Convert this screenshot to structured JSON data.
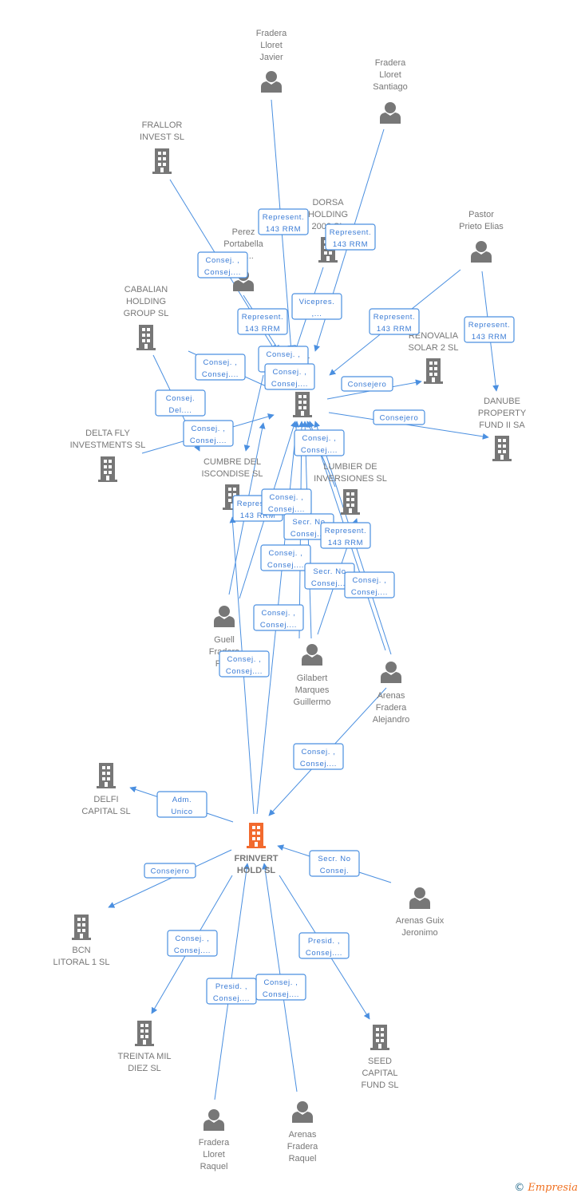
{
  "colors": {
    "edge": "#4a8fe0",
    "edge_text": "#3a7bd5",
    "node_icon": "#777777",
    "main_node": "#f26a2e"
  },
  "nodes": [
    {
      "id": "fradera_javier",
      "type": "person",
      "label": [
        "Fradera",
        "Lloret",
        "Javier"
      ]
    },
    {
      "id": "fradera_santiago",
      "type": "person",
      "label": [
        "Fradera",
        "Lloret",
        "Santiago"
      ]
    },
    {
      "id": "frallor",
      "type": "company",
      "label": [
        "FRALLOR",
        "INVEST SL"
      ]
    },
    {
      "id": "dorsa",
      "type": "company",
      "label": [
        "DORSA",
        "HOLDING",
        "2002 SL"
      ]
    },
    {
      "id": "perez",
      "type": "person",
      "label": [
        "Perez",
        "Portabella",
        "Fra..."
      ]
    },
    {
      "id": "pastor",
      "type": "person",
      "label": [
        "Pastor",
        "Prieto Elias"
      ]
    },
    {
      "id": "cabalian",
      "type": "company",
      "label": [
        "CABALIAN",
        "HOLDING",
        "GROUP SL"
      ]
    },
    {
      "id": "renovalia",
      "type": "company",
      "label": [
        "RENOVALIA",
        "SOLAR 2 SL"
      ]
    },
    {
      "id": "central",
      "type": "company",
      "label": [
        "MIL",
        "OS"
      ]
    },
    {
      "id": "danube",
      "type": "company",
      "label": [
        "DANUBE",
        "PROPERTY",
        "FUND II SA"
      ]
    },
    {
      "id": "delta",
      "type": "company",
      "label": [
        "DELTA FLY",
        "INVESTMENTS SL"
      ]
    },
    {
      "id": "cumbre",
      "type": "company",
      "label": [
        "CUMBRE DEL",
        "ISCONDISE SL"
      ]
    },
    {
      "id": "lumbier",
      "type": "company",
      "label": [
        "LUMBIER DE",
        "INVERSIONES SL"
      ]
    },
    {
      "id": "guell",
      "type": "person",
      "label": [
        "Guell",
        "Fradera",
        "Pa..."
      ]
    },
    {
      "id": "gilabert",
      "type": "person",
      "label": [
        "Gilabert",
        "Marques",
        "Guillermo"
      ]
    },
    {
      "id": "arenas_alejandro",
      "type": "person",
      "label": [
        "Arenas",
        "Fradera",
        "Alejandro"
      ]
    },
    {
      "id": "delfi",
      "type": "company",
      "label": [
        "DELFI",
        "CAPITAL  SL"
      ]
    },
    {
      "id": "frinvert",
      "type": "main",
      "label": [
        "FRINVERT",
        "HOLD SL"
      ]
    },
    {
      "id": "arenas_guix",
      "type": "person",
      "label": [
        "Arenas Guix",
        "Jeronimo"
      ]
    },
    {
      "id": "bcn",
      "type": "company",
      "label": [
        "BCN",
        "LITORAL 1 SL"
      ]
    },
    {
      "id": "treinta",
      "type": "company",
      "label": [
        "TREINTA MIL",
        "DIEZ SL"
      ]
    },
    {
      "id": "seed",
      "type": "company",
      "label": [
        "SEED",
        "CAPITAL",
        "FUND SL"
      ]
    },
    {
      "id": "fradera_raquel",
      "type": "person",
      "label": [
        "Fradera",
        "Lloret",
        "Raquel"
      ]
    },
    {
      "id": "arenas_raquel",
      "type": "person",
      "label": [
        "Arenas",
        "Fradera",
        "Raquel"
      ]
    }
  ],
  "edges": [
    [
      "Represent.",
      "143 RRM"
    ],
    [
      "Represent.",
      "143 RRM"
    ],
    [
      "Consej. ,",
      "Consej...."
    ],
    [
      "Represent.",
      "143 RRM"
    ],
    [
      "Vicepres.",
      ",..."
    ],
    [
      "Represent.",
      "143 RRM"
    ],
    [
      "Represent.",
      "143 RRM"
    ],
    [
      "Consej. ,",
      "Consej...."
    ],
    [
      "Consej. ,",
      "Consej...."
    ],
    [
      "Consej. ,",
      "Consej...."
    ],
    [
      "Consejero"
    ],
    [
      "Consejero"
    ],
    [
      "Consej.",
      "Del...."
    ],
    [
      "Consej. ,",
      "Consej...."
    ],
    [
      "Consej. ,",
      "Consej...."
    ],
    [
      "Represent.",
      "143 RRM"
    ],
    [
      "Consej. ,",
      "Consej...."
    ],
    [
      "Secr. No",
      "Consej...."
    ],
    [
      "Represent.",
      "143 RRM"
    ],
    [
      "Consej. ,",
      "Consej...."
    ],
    [
      "Secr. No",
      "Consej...."
    ],
    [
      "Consej. ,",
      "Consej...."
    ],
    [
      "Consej. ,",
      "Consej...."
    ],
    [
      "Consej. ,",
      "Consej...."
    ],
    [
      "Consej. ,",
      "Consej...."
    ],
    [
      "Adm.",
      "Unico"
    ],
    [
      "Secr. No",
      "Consej."
    ],
    [
      "Consejero"
    ],
    [
      "Consej. ,",
      "Consej...."
    ],
    [
      "Presid. ,",
      "Consej...."
    ],
    [
      "Presid. ,",
      "Consej...."
    ],
    [
      "Consej. ,",
      "Consej...."
    ]
  ],
  "brand": {
    "copyright": "©",
    "name": "Empresia"
  }
}
